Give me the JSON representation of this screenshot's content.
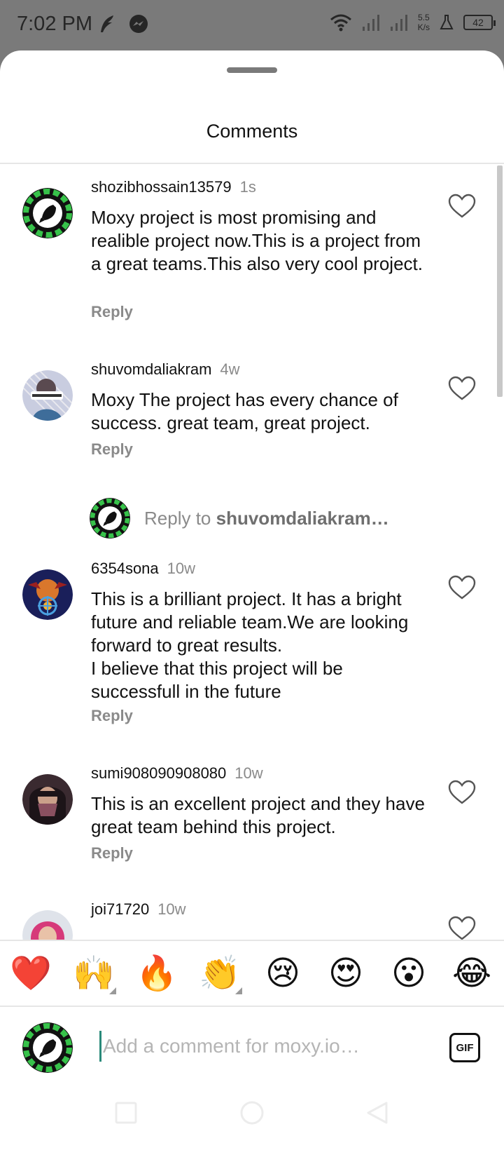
{
  "status_bar": {
    "time": "7:02 PM",
    "net_speed_value": "5.5",
    "net_speed_unit": "K/s",
    "battery": "42"
  },
  "sheet": {
    "title": "Comments"
  },
  "comments": [
    {
      "username": "shozibhossain13579",
      "time": "1s",
      "text": "Moxy project is most promising and realible project now.This is a project from a great teams.This also very cool project.",
      "reply_label": "Reply"
    },
    {
      "username": "shuvomdaliakram",
      "time": "4w",
      "text": "Moxy The project has every chance of success. great team, great project.",
      "reply_label": "Reply"
    },
    {
      "username": "6354sona",
      "time": "10w",
      "text": "This is a brilliant project. It has a bright future and reliable team.We are looking forward to great results.\nI believe that this project will be successfull in the future",
      "reply_label": "Reply"
    },
    {
      "username": "sumi908090908080",
      "time": "10w",
      "text": "This is an excellent project and they have great team behind this project.",
      "reply_label": "Reply"
    },
    {
      "username": "joi71720",
      "time": "10w",
      "text": "",
      "reply_label": ""
    }
  ],
  "reply_to": {
    "prefix": "Reply to",
    "username": "shuvomdaliakram…"
  },
  "emoji_bar": [
    "❤️",
    "🙌",
    "🔥",
    "👏",
    "😢",
    "😍",
    "😮",
    "😂"
  ],
  "composer": {
    "placeholder": "Add a comment for moxy.io…",
    "gif_label": "GIF"
  },
  "colors": {
    "accent_green": "#37c24a",
    "status_bar_bg": "#7a7a7a",
    "secondary_text": "#8a8a8a"
  }
}
